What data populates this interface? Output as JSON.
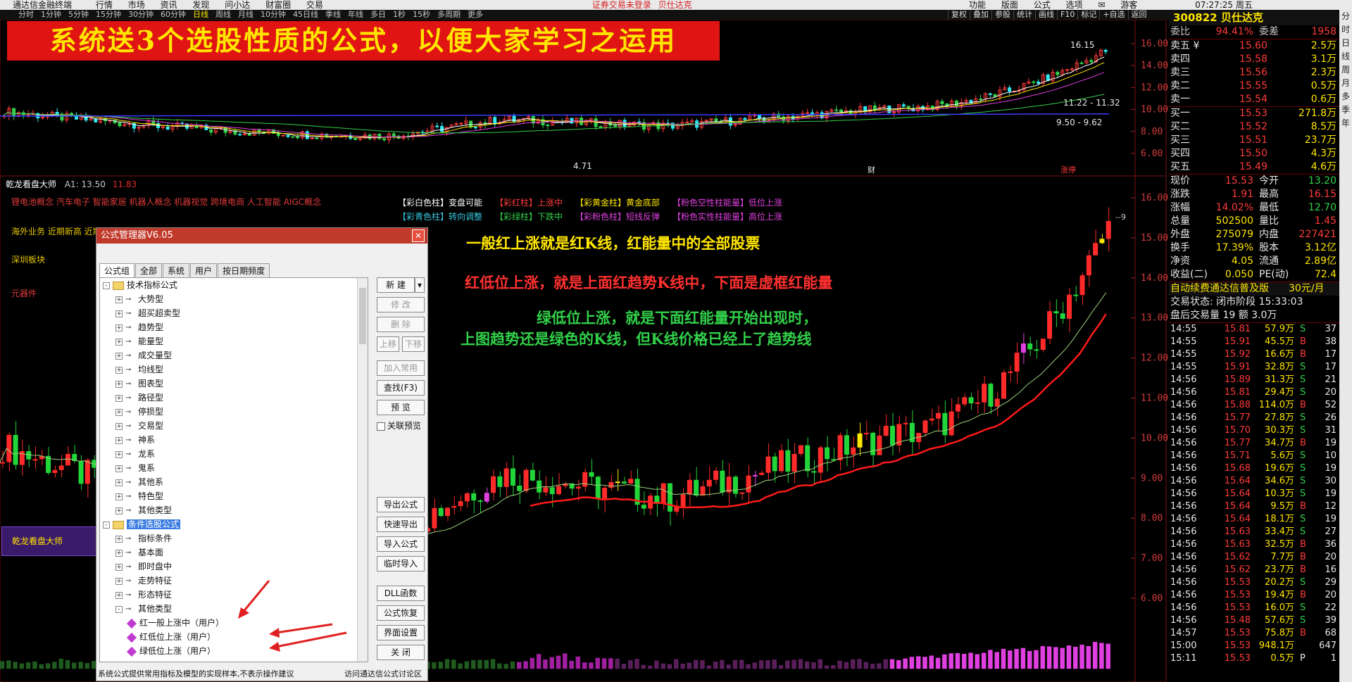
{
  "menu": {
    "app_name": "通达信金融终端",
    "items": [
      "行情",
      "市场",
      "资讯",
      "发现",
      "问小达",
      "财富圈",
      "交易"
    ],
    "notice": "证券交易未登录",
    "stock_short": "贝仕达克",
    "right_items": [
      "功能",
      "版面",
      "公式",
      "选项",
      "游客"
    ],
    "time": "07:27:25 周五"
  },
  "periods": [
    "分时",
    "1分钟",
    "5分钟",
    "15分钟",
    "30分钟",
    "60分钟",
    "日线",
    "周线",
    "月线",
    "10分钟",
    "45日线",
    "季线",
    "年线",
    "多日",
    "1秒",
    "15秒",
    "多周期",
    "更多"
  ],
  "toolbar": [
    "复权",
    "叠加",
    "参股",
    "统计",
    "画线",
    "F10",
    "标记",
    "+自选",
    "返回"
  ],
  "banner": "系统送3个选股性质的公式，以便大家学习之运用",
  "indicator": {
    "title": "乾龙看盘大师",
    "a1_label": "A1: 13.50",
    "a1_value": "11.83",
    "concepts": "锂电池概念 汽车电子 智能家居 机器人概念 机器视觉 跨境电商 人工智能 AIGC概念",
    "line2": "海外业务 近期新高 近期强势 通达信热股",
    "line3": "深圳板块",
    "line4": "元器件",
    "box_label": "乾龙看盘大师"
  },
  "legend": [
    {
      "text": "【彩白色柱】变盘可能",
      "color": "#ffffff"
    },
    {
      "text": "【彩红柱】上涨中",
      "color": "#ff3b3b"
    },
    {
      "text": "【彩黄金柱】黄金底部",
      "color": "#ffe600"
    },
    {
      "text": "【粉色空性柱能量】低位上涨",
      "color": "#e040e0"
    },
    {
      "text": "【彩青色柱】转向调整",
      "color": "#37c8e0"
    },
    {
      "text": "【彩绿柱】下跌中",
      "color": "#32d04a"
    },
    {
      "text": "【彩粉色柱】短线反弹",
      "color": "#e040e0"
    },
    {
      "text": "【粉色实性柱能量】高位上涨",
      "color": "#e040e0"
    }
  ],
  "annotations": {
    "a1": "一般红上涨就是红K线，红能量中的全部股票",
    "a2": "红低位上涨，就是上面红趋势K线中，下面是虚框红能量",
    "a3": "绿低位上涨，就是下面红能量开始出现时，",
    "a4": "上图趋势还是绿色的K线，但K线价格已经上了趋势线"
  },
  "price_chart": {
    "y_labels": [
      "16.00",
      "14.00",
      "12.00",
      "10.00",
      "8.00",
      "6.00"
    ],
    "labels": {
      "high": "16.15",
      "low": "4.71",
      "ma_a": "11.22 - 11.32",
      "ma_b": "9.50 - 9.62",
      "mark1": "财",
      "mark2": "涨停"
    }
  },
  "lower_chart": {
    "y_labels": [
      "16.00",
      "15.00",
      "14.00",
      "13.00",
      "12.00",
      "11.00",
      "10.00",
      "9.00",
      "8.00",
      "7.00",
      "6.00"
    ],
    "high_mark": "9"
  },
  "dialog": {
    "title": "公式管理器V6.05",
    "tabs": [
      "公式组",
      "全部",
      "系统",
      "用户",
      "按日期频度"
    ],
    "tree": [
      {
        "level": 0,
        "type": "folder",
        "label": "技术指标公式",
        "exp": "-"
      },
      {
        "level": 1,
        "type": "node",
        "label": "大势型"
      },
      {
        "level": 1,
        "type": "node",
        "label": "超买超卖型"
      },
      {
        "level": 1,
        "type": "node",
        "label": "趋势型"
      },
      {
        "level": 1,
        "type": "node",
        "label": "能量型"
      },
      {
        "level": 1,
        "type": "node",
        "label": "成交量型"
      },
      {
        "level": 1,
        "type": "node",
        "label": "均线型"
      },
      {
        "level": 1,
        "type": "node",
        "label": "图表型"
      },
      {
        "level": 1,
        "type": "node",
        "label": "路径型"
      },
      {
        "level": 1,
        "type": "node",
        "label": "停损型"
      },
      {
        "level": 1,
        "type": "node",
        "label": "交易型"
      },
      {
        "level": 1,
        "type": "node",
        "label": "神系"
      },
      {
        "level": 1,
        "type": "node",
        "label": "龙系"
      },
      {
        "level": 1,
        "type": "node",
        "label": "鬼系"
      },
      {
        "level": 1,
        "type": "node",
        "label": "其他系"
      },
      {
        "level": 1,
        "type": "node",
        "label": "特色型"
      },
      {
        "level": 1,
        "type": "node",
        "label": "其他类型"
      },
      {
        "level": 0,
        "type": "folder",
        "label": "条件选股公式",
        "exp": "-",
        "selected": true
      },
      {
        "level": 1,
        "type": "node",
        "label": "指标条件"
      },
      {
        "level": 1,
        "type": "node",
        "label": "基本面"
      },
      {
        "level": 1,
        "type": "node",
        "label": "即时盘中"
      },
      {
        "level": 1,
        "type": "node",
        "label": "走势特征"
      },
      {
        "level": 1,
        "type": "node",
        "label": "形态特征"
      },
      {
        "level": 1,
        "type": "node",
        "label": "其他类型",
        "exp": "-"
      },
      {
        "level": 2,
        "type": "formula",
        "label": "红一般上涨中（用户）"
      },
      {
        "level": 2,
        "type": "formula",
        "label": "红低位上涨（用户）"
      },
      {
        "level": 2,
        "type": "formula",
        "label": "绿低位上涨（用户）"
      }
    ],
    "buttons": {
      "new": "新 建",
      "modify": "修 改",
      "delete": "删 除",
      "up": "上移",
      "down": "下移",
      "add_common": "加入常用",
      "find": "查找(F3)",
      "preview": "预 览",
      "linked_preview": "关联预览",
      "export": "导出公式",
      "quick_export": "快速导出",
      "import": "导入公式",
      "temp_import": "临时导入",
      "dll": "DLL函数",
      "restore": "公式恢复",
      "ui_settings": "界面设置",
      "close": "关 闭"
    },
    "status": "系统公式提供常用指标及模型的实现样本,不表示操作建议",
    "link": "访问通达信公式讨论区"
  },
  "quote": {
    "header": "300822 贝仕达克",
    "ratio": {
      "label": "委比",
      "value": "94.41%",
      "label2": "委差",
      "value2": "1958"
    },
    "asks": [
      {
        "label": "卖五 ¥",
        "price": "15.60",
        "vol": "2.5万"
      },
      {
        "label": "卖四",
        "price": "15.58",
        "vol": "3.1万"
      },
      {
        "label": "卖三",
        "price": "15.56",
        "vol": "2.3万"
      },
      {
        "label": "卖二",
        "price": "15.55",
        "vol": "0.5万"
      },
      {
        "label": "卖一",
        "price": "15.54",
        "vol": "0.6万"
      }
    ],
    "bids": [
      {
        "label": "买一",
        "price": "15.53",
        "vol": "271.8万"
      },
      {
        "label": "买二",
        "price": "15.52",
        "vol": "8.5万"
      },
      {
        "label": "买三",
        "price": "15.51",
        "vol": "23.7万"
      },
      {
        "label": "买四",
        "price": "15.50",
        "vol": "4.3万"
      },
      {
        "label": "买五",
        "price": "15.49",
        "vol": "4.6万"
      }
    ],
    "stats": [
      {
        "l1": "现价",
        "v1": "15.53",
        "l2": "今开",
        "v2": "13.20"
      },
      {
        "l1": "涨跌",
        "v1": "1.91",
        "l2": "最高",
        "v2": "16.15"
      },
      {
        "l1": "涨幅",
        "v1": "14.02%",
        "l2": "最低",
        "v2": "12.70"
      },
      {
        "l1": "总量",
        "v1": "502500",
        "l2": "量比",
        "v2": "1.45"
      },
      {
        "l1": "外盘",
        "v1": "275079",
        "l2": "内盘",
        "v2": "227421"
      },
      {
        "l1": "换手",
        "v1": "17.39%",
        "l2": "股本",
        "v2": "3.12亿"
      },
      {
        "l1": "净资",
        "v1": "4.05",
        "l2": "流通",
        "v2": "2.89亿"
      },
      {
        "l1": "收益(二)",
        "v1": "0.050",
        "l2": "PE(动)",
        "v2": "72.4"
      }
    ],
    "promo": "自动续费通达信普及版",
    "promo_price": "30元/月",
    "trade_status": "交易状态: 闭市阶段 15:33:03",
    "after_hours": "盘后交易量 19 额 3.0万",
    "ticks": [
      {
        "t": "14:55",
        "p": "15.81",
        "v": "57.9万",
        "s": "S",
        "n": "37"
      },
      {
        "t": "14:55",
        "p": "15.91",
        "v": "45.5万",
        "s": "B",
        "n": "38"
      },
      {
        "t": "14:55",
        "p": "15.92",
        "v": "16.6万",
        "s": "B",
        "n": "17"
      },
      {
        "t": "14:55",
        "p": "15.91",
        "v": "32.8万",
        "s": "S",
        "n": "17"
      },
      {
        "t": "14:56",
        "p": "15.89",
        "v": "31.3万",
        "s": "S",
        "n": "21"
      },
      {
        "t": "14:56",
        "p": "15.81",
        "v": "29.4万",
        "s": "S",
        "n": "20"
      },
      {
        "t": "14:56",
        "p": "15.88",
        "v": "114.0万",
        "s": "B",
        "n": "52"
      },
      {
        "t": "14:56",
        "p": "15.77",
        "v": "27.8万",
        "s": "S",
        "n": "26"
      },
      {
        "t": "14:56",
        "p": "15.70",
        "v": "30.3万",
        "s": "S",
        "n": "31"
      },
      {
        "t": "14:56",
        "p": "15.77",
        "v": "34.7万",
        "s": "B",
        "n": "19"
      },
      {
        "t": "14:56",
        "p": "15.71",
        "v": "5.6万",
        "s": "S",
        "n": "10"
      },
      {
        "t": "14:56",
        "p": "15.68",
        "v": "19.6万",
        "s": "S",
        "n": "19"
      },
      {
        "t": "14:56",
        "p": "15.64",
        "v": "34.6万",
        "s": "S",
        "n": "30"
      },
      {
        "t": "14:56",
        "p": "15.64",
        "v": "10.3万",
        "s": "S",
        "n": "19"
      },
      {
        "t": "14:56",
        "p": "15.64",
        "v": "9.5万",
        "s": "B",
        "n": "12"
      },
      {
        "t": "14:56",
        "p": "15.64",
        "v": "18.1万",
        "s": "S",
        "n": "19"
      },
      {
        "t": "14:56",
        "p": "15.63",
        "v": "33.4万",
        "s": "S",
        "n": "27"
      },
      {
        "t": "14:56",
        "p": "15.63",
        "v": "32.5万",
        "s": "B",
        "n": "36"
      },
      {
        "t": "14:56",
        "p": "15.62",
        "v": "7.7万",
        "s": "B",
        "n": "20"
      },
      {
        "t": "14:56",
        "p": "15.62",
        "v": "23.7万",
        "s": "B",
        "n": "16"
      },
      {
        "t": "14:56",
        "p": "15.53",
        "v": "20.2万",
        "s": "S",
        "n": "29"
      },
      {
        "t": "14:56",
        "p": "15.53",
        "v": "19.4万",
        "s": "B",
        "n": "20"
      },
      {
        "t": "14:56",
        "p": "15.53",
        "v": "16.0万",
        "s": "S",
        "n": "22"
      },
      {
        "t": "14:56",
        "p": "15.48",
        "v": "57.6万",
        "s": "S",
        "n": "39"
      },
      {
        "t": "14:57",
        "p": "15.53",
        "v": "75.8万",
        "s": "B",
        "n": "68"
      },
      {
        "t": "15:00",
        "p": "15.53",
        "v": "948.1万",
        "s": "",
        "n": "647"
      },
      {
        "t": "15:11",
        "p": "15.53",
        "v": "0.5万",
        "s": "P",
        "n": "1"
      }
    ]
  },
  "sidebar": [
    "分",
    "时",
    "日",
    "线",
    "周",
    "月",
    "多",
    "季",
    "年"
  ],
  "colors": {
    "up": "#ff3b3b",
    "down": "#32d04a",
    "banner_bg": "#e11414",
    "banner_fg": "#ffe600",
    "magenta": "#e040e0"
  }
}
